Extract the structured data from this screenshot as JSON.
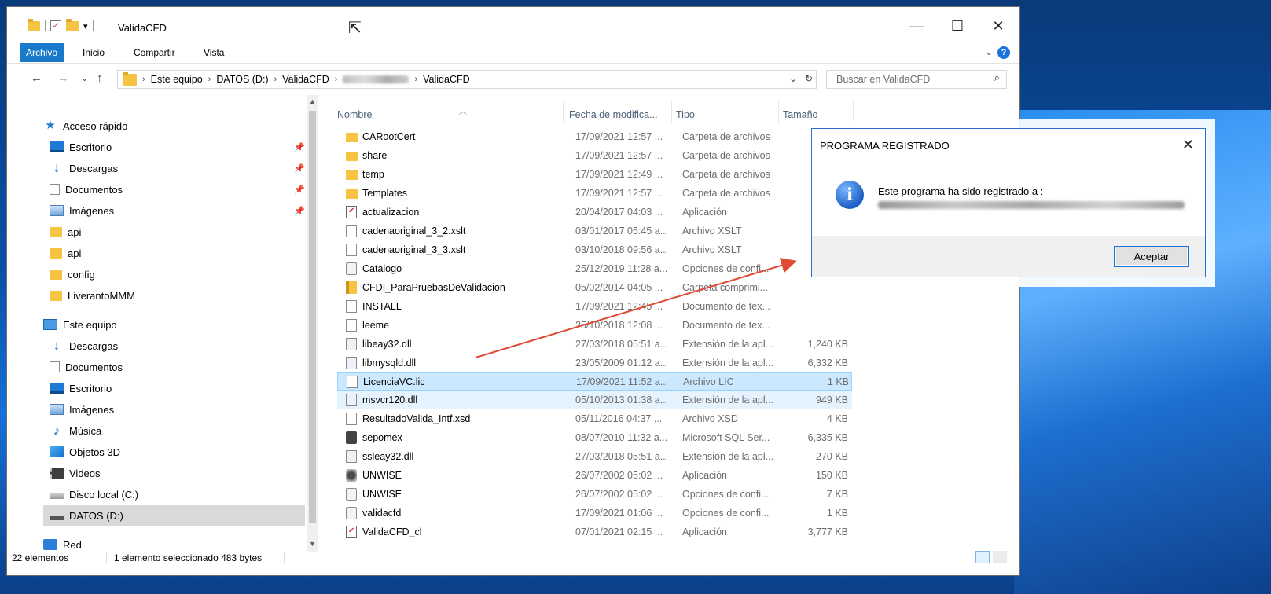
{
  "window": {
    "title": "ValidaCFD",
    "qa_chevron": "▾",
    "minimize": "—",
    "maximize": "☐",
    "close": "✕"
  },
  "ribbon": {
    "tabs": [
      "Archivo",
      "Inicio",
      "Compartir",
      "Vista"
    ],
    "expand": "⌄",
    "help": "?"
  },
  "address": {
    "back": "←",
    "forward": "→",
    "recent": "⌄",
    "up": "↑",
    "crumbs": [
      "Este equipo",
      "DATOS (D:)",
      "ValidaCFD",
      "ValidaCFD"
    ],
    "separator": "›",
    "dropdown": "⌄",
    "refresh": "↻",
    "search_placeholder": "Buscar en ValidaCFD",
    "search_icon": "⌕"
  },
  "nav": {
    "pin_glyph": "📌",
    "items": [
      {
        "label": "Acceso rápido",
        "icon": "star-icon",
        "pinned": false
      },
      {
        "label": "Escritorio",
        "icon": "desktop-icon",
        "pinned": true
      },
      {
        "label": "Descargas",
        "icon": "download-icon",
        "pinned": true
      },
      {
        "label": "Documentos",
        "icon": "document-icon",
        "pinned": true
      },
      {
        "label": "Imágenes",
        "icon": "pictures-icon",
        "pinned": true
      },
      {
        "label": "api",
        "icon": "folder-icon",
        "pinned": false
      },
      {
        "label": "api",
        "icon": "folder-icon",
        "pinned": false
      },
      {
        "label": "config",
        "icon": "folder-icon",
        "pinned": false
      },
      {
        "label": "LiverantoMMM",
        "icon": "folder-icon",
        "pinned": false
      },
      {
        "label": "Este equipo",
        "icon": "computer-icon",
        "pinned": false
      },
      {
        "label": "Descargas",
        "icon": "download-icon",
        "pinned": false
      },
      {
        "label": "Documentos",
        "icon": "document-icon",
        "pinned": false
      },
      {
        "label": "Escritorio",
        "icon": "desktop-icon",
        "pinned": false
      },
      {
        "label": "Imágenes",
        "icon": "pictures-icon",
        "pinned": false
      },
      {
        "label": "Música",
        "icon": "music-icon",
        "pinned": false
      },
      {
        "label": "Objetos 3D",
        "icon": "objects-3d-icon",
        "pinned": false
      },
      {
        "label": "Videos",
        "icon": "video-icon",
        "pinned": false
      },
      {
        "label": "Disco local (C:)",
        "icon": "drive-c-icon",
        "pinned": false
      },
      {
        "label": "DATOS (D:)",
        "icon": "drive-d-icon",
        "pinned": false
      },
      {
        "label": "Red",
        "icon": "network-icon",
        "pinned": false
      }
    ]
  },
  "columns": {
    "name": "Nombre",
    "date": "Fecha de modifica...",
    "type": "Tipo",
    "size": "Tamaño"
  },
  "files": [
    {
      "name": "CARootCert",
      "date": "17/09/2021 12:57 ...",
      "type": "Carpeta de archivos",
      "size": "",
      "icon": "folder-icon"
    },
    {
      "name": "share",
      "date": "17/09/2021 12:57 ...",
      "type": "Carpeta de archivos",
      "size": "",
      "icon": "folder-icon"
    },
    {
      "name": "temp",
      "date": "17/09/2021 12:49 ...",
      "type": "Carpeta de archivos",
      "size": "",
      "icon": "folder-icon"
    },
    {
      "name": "Templates",
      "date": "17/09/2021 12:57 ...",
      "type": "Carpeta de archivos",
      "size": "",
      "icon": "folder-icon"
    },
    {
      "name": "actualizacion",
      "date": "20/04/2017 04:03 ...",
      "type": "Aplicación",
      "size": "",
      "icon": "application-icon"
    },
    {
      "name": "cadenaoriginal_3_2.xslt",
      "date": "03/01/2017 05:45 a...",
      "type": "Archivo XSLT",
      "size": "",
      "icon": "file-icon"
    },
    {
      "name": "cadenaoriginal_3_3.xslt",
      "date": "03/10/2018 09:56 a...",
      "type": "Archivo XSLT",
      "size": "",
      "icon": "file-icon"
    },
    {
      "name": "Catalogo",
      "date": "25/12/2019 11:28 a...",
      "type": "Opciones de confi...",
      "size": "",
      "icon": "config-file-icon"
    },
    {
      "name": "CFDI_ParaPruebasDeValidacion",
      "date": "05/02/2014 04:05 ...",
      "type": "Carpeta comprimi...",
      "size": "",
      "icon": "zip-folder-icon"
    },
    {
      "name": "INSTALL",
      "date": "17/09/2021 12:45 ...",
      "type": "Documento de tex...",
      "size": "",
      "icon": "text-file-icon"
    },
    {
      "name": "leeme",
      "date": "25/10/2018 12:08 ...",
      "type": "Documento de tex...",
      "size": "",
      "icon": "text-file-icon"
    },
    {
      "name": "libeay32.dll",
      "date": "27/03/2018 05:51 a...",
      "type": "Extensión de la apl...",
      "size": "1,240 KB",
      "icon": "dll-icon"
    },
    {
      "name": "libmysqld.dll",
      "date": "23/05/2009 01:12 a...",
      "type": "Extensión de la apl...",
      "size": "6,332 KB",
      "icon": "dll-icon"
    },
    {
      "name": "LicenciaVC.lic",
      "date": "17/09/2021 11:52 a...",
      "type": "Archivo LIC",
      "size": "1 KB",
      "icon": "file-icon"
    },
    {
      "name": "msvcr120.dll",
      "date": "05/10/2013 01:38 a...",
      "type": "Extensión de la apl...",
      "size": "949 KB",
      "icon": "dll-icon"
    },
    {
      "name": "ResultadoValida_Intf.xsd",
      "date": "05/11/2016 04:37 ...",
      "type": "Archivo XSD",
      "size": "4 KB",
      "icon": "file-icon"
    },
    {
      "name": "sepomex",
      "date": "08/07/2010 11:32 a...",
      "type": "Microsoft SQL Ser...",
      "size": "6,335 KB",
      "icon": "sql-file-icon"
    },
    {
      "name": "ssleay32.dll",
      "date": "27/03/2018 05:51 a...",
      "type": "Extensión de la apl...",
      "size": "270 KB",
      "icon": "dll-icon"
    },
    {
      "name": "UNWISE",
      "date": "26/07/2002 05:02 ...",
      "type": "Aplicación",
      "size": "150 KB",
      "icon": "setup-icon"
    },
    {
      "name": "UNWISE",
      "date": "26/07/2002 05:02 ...",
      "type": "Opciones de confi...",
      "size": "7 KB",
      "icon": "config-file-icon"
    },
    {
      "name": "validacfd",
      "date": "17/09/2021 01:06 ...",
      "type": "Opciones de confi...",
      "size": "1 KB",
      "icon": "config-file-icon"
    },
    {
      "name": "ValidaCFD_cl",
      "date": "07/01/2021 02:15 ...",
      "type": "Aplicación",
      "size": "3,777 KB",
      "icon": "application-icon"
    }
  ],
  "status": {
    "count": "22 elementos",
    "selection": "1 elemento seleccionado  483 bytes"
  },
  "dialog": {
    "title": "PROGRAMA REGISTRADO",
    "close": "✕",
    "message": "Este programa ha sido registrado a :",
    "info_glyph": "i",
    "ok_label": "Aceptar"
  },
  "colors": {
    "accent": "#1979ca",
    "arrow": "#e04a34",
    "selection": "#cce8ff"
  }
}
